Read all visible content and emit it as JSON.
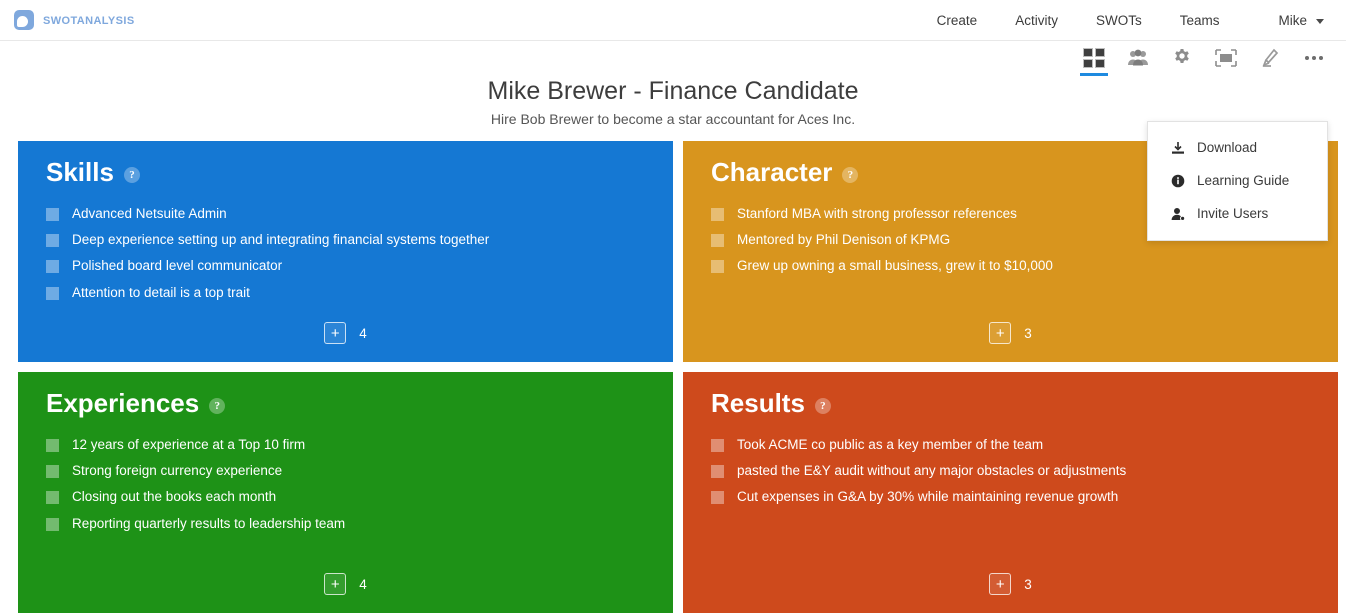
{
  "brand": {
    "name": "swotanalysis",
    "logo_icon": "swot-logo-icon"
  },
  "nav": {
    "links": [
      {
        "label": "Create"
      },
      {
        "label": "Activity"
      },
      {
        "label": "SWOTs"
      },
      {
        "label": "Teams"
      }
    ],
    "user": {
      "label": "Mike",
      "caret_icon": "chevron-down-icon"
    }
  },
  "toolbar": {
    "items": [
      {
        "name": "grid-view",
        "icon": "grid-icon",
        "active": true
      },
      {
        "name": "team",
        "icon": "people-icon",
        "active": false
      },
      {
        "name": "settings",
        "icon": "gear-icon",
        "active": false
      },
      {
        "name": "presentation",
        "icon": "fullscreen-icon",
        "active": false
      },
      {
        "name": "highlighter",
        "icon": "pen-icon",
        "active": false
      },
      {
        "name": "more",
        "icon": "ellipsis-icon",
        "active": false
      }
    ]
  },
  "dropdown": {
    "items": [
      {
        "label": "Download",
        "icon": "download-icon"
      },
      {
        "label": "Learning Guide",
        "icon": "info-icon"
      },
      {
        "label": "Invite Users",
        "icon": "person-add-icon"
      }
    ]
  },
  "document": {
    "title": "Mike Brewer - Finance Candidate",
    "subtitle": "Hire Bob Brewer to become a star accountant for Aces Inc."
  },
  "colors": {
    "skills": "#1578d3",
    "character": "#d8951e",
    "experiences": "#1e9217",
    "results": "#ce4a1c",
    "accent": "#1e8ae0",
    "brand": "#7fa8dd"
  },
  "quadrants": [
    {
      "key": "skills",
      "title": "Skills",
      "help_icon": "help-circle-icon",
      "add_label": "+",
      "count": "4",
      "items": [
        "Advanced Netsuite Admin",
        "Deep experience setting up and integrating financial systems together",
        "Polished board level communicator",
        "Attention to detail is a top trait"
      ]
    },
    {
      "key": "character",
      "title": "Character",
      "help_icon": "help-circle-icon",
      "add_label": "+",
      "count": "3",
      "items": [
        "Stanford MBA with strong professor references",
        "Mentored by Phil Denison of KPMG",
        "Grew up owning a small business, grew it to $10,000"
      ]
    },
    {
      "key": "experiences",
      "title": "Experiences",
      "help_icon": "help-circle-icon",
      "add_label": "+",
      "count": "4",
      "items": [
        "12 years of experience at a Top 10 firm",
        "Strong foreign currency experience",
        "Closing out the books each month",
        "Reporting quarterly results to leadership team"
      ]
    },
    {
      "key": "results",
      "title": "Results",
      "help_icon": "help-circle-icon",
      "add_label": "+",
      "count": "3",
      "items": [
        "Took ACME co public as a key member of the team",
        "pasted the E&Y audit without any major obstacles or adjustments",
        "Cut expenses in G&A by 30% while maintaining revenue growth"
      ]
    }
  ]
}
